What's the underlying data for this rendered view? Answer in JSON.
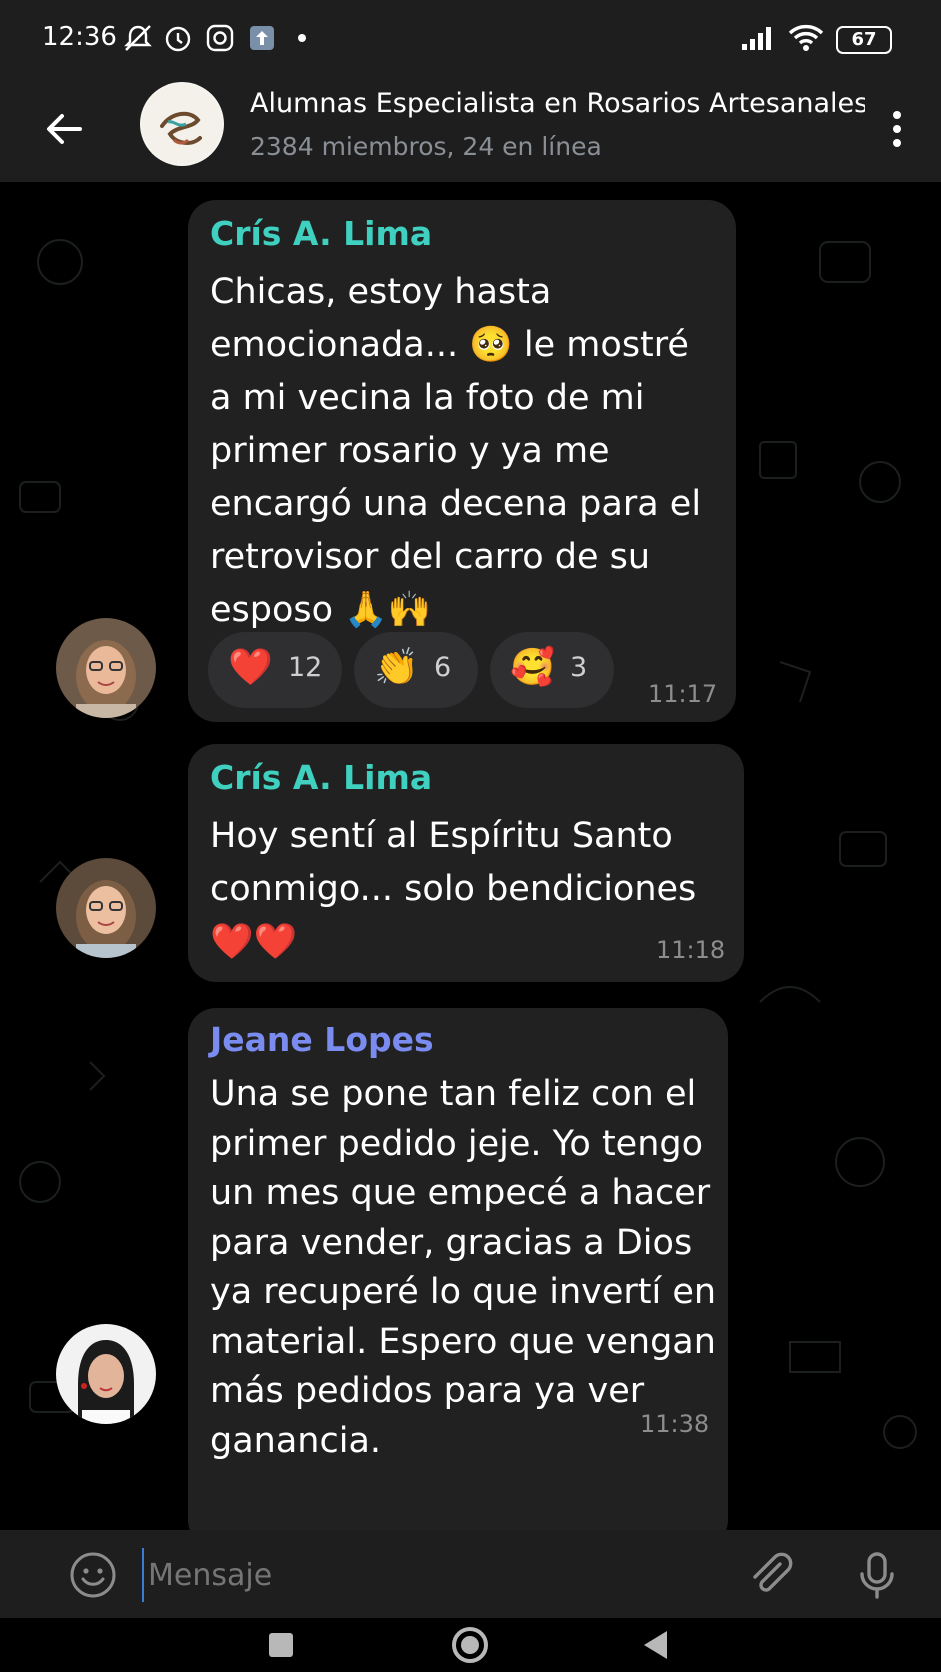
{
  "status": {
    "time": "12:36",
    "battery": "67"
  },
  "header": {
    "title": "Alumnas Especialista en Rosarios Artesanales",
    "subtitle": "2384 miembros, 24 en línea"
  },
  "messages": [
    {
      "sender": "Crís A. Lima",
      "text": "Chicas, estoy hasta\nemocionada... 🥺 le mostré\na mi vecina la foto de mi\nprimer rosario y ya me\nencargó una decena para el\nretrovisor del carro de su\nesposo 🙏🙌",
      "time": "11:17",
      "reactions": [
        {
          "emoji": "❤️",
          "count": "12"
        },
        {
          "emoji": "👏",
          "count": "6"
        },
        {
          "emoji": "🥰",
          "count": "3"
        }
      ]
    },
    {
      "sender": "Crís A. Lima",
      "text": "Hoy sentí al Espíritu Santo\nconmigo... solo bendiciones\n❤️❤️",
      "time": "11:18"
    },
    {
      "sender": "Jeane Lopes",
      "text": "Una se pone tan feliz con el\nprimer pedido jeje. Yo tengo\nun mes que empecé a hacer\npara vender, gracias a Dios\nya recuperé lo que invertí en\nmaterial. Espero que vengan\nmás pedidos para ya ver\nganancia.",
      "time": "11:38"
    }
  ],
  "composer": {
    "placeholder": "Mensaje"
  },
  "colors": {
    "sender_cris": "#3fd0c0",
    "sender_jeane": "#7b8cf0",
    "bubble": "#212121",
    "bar": "#1e1e1e"
  }
}
